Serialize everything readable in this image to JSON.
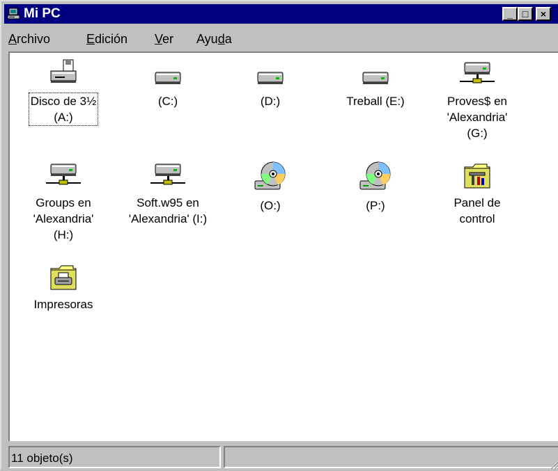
{
  "window": {
    "title": "Mi PC"
  },
  "title_buttons": {
    "minimize": "_",
    "maximize": "□",
    "close": "×"
  },
  "menu": [
    {
      "label_pre": "",
      "mnemonic": "A",
      "label_post": "rchivo"
    },
    {
      "label_pre": "",
      "mnemonic": "E",
      "label_post": "dición"
    },
    {
      "label_pre": "",
      "mnemonic": "V",
      "label_post": "er"
    },
    {
      "label_pre": "Ayu",
      "mnemonic": "d",
      "label_post": "a"
    }
  ],
  "items": [
    {
      "label": "Disco de 3½\n(A:)",
      "icon": "floppy-drive-icon"
    },
    {
      "label": "(C:)",
      "icon": "hard-drive-icon"
    },
    {
      "label": "(D:)",
      "icon": "hard-drive-icon"
    },
    {
      "label": "Treball (E:)",
      "icon": "hard-drive-icon"
    },
    {
      "label": "Proves$ en\n'Alexandria'\n(G:)",
      "icon": "network-drive-icon"
    },
    {
      "label": "Groups en\n'Alexandria'\n(H:)",
      "icon": "network-drive-icon"
    },
    {
      "label": "Soft.w95 en\n'Alexandria' (I:)",
      "icon": "network-drive-icon"
    },
    {
      "label": "(O:)",
      "icon": "cd-drive-icon"
    },
    {
      "label": "(P:)",
      "icon": "cd-drive-icon"
    },
    {
      "label": "Panel de\ncontrol",
      "icon": "control-panel-folder-icon"
    },
    {
      "label": "Impresoras",
      "icon": "printers-folder-icon"
    }
  ],
  "status": {
    "count": "11 objeto(s)",
    "extra": ""
  }
}
